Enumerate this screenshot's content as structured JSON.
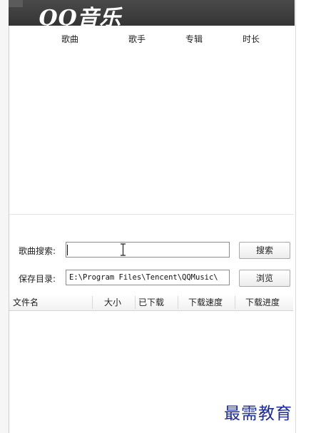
{
  "app": {
    "logo_text": "QQ音乐"
  },
  "song_list": {
    "columns": [
      "歌曲",
      "歌手",
      "专辑",
      "时长"
    ],
    "rows": []
  },
  "search": {
    "label": "歌曲搜索:",
    "value": "",
    "button_label": "搜索"
  },
  "save_dir": {
    "label": "保存目录:",
    "value": "E:\\Program Files\\Tencent\\QQMusic\\",
    "button_label": "浏览"
  },
  "downloads": {
    "columns": [
      "文件名",
      "大小",
      "已下载",
      "下载速度",
      "下载进度"
    ],
    "rows": []
  },
  "watermark": {
    "text": "最需教育"
  },
  "colors": {
    "banner": "#3c3c3c",
    "watermark": "#1c2a9a"
  }
}
